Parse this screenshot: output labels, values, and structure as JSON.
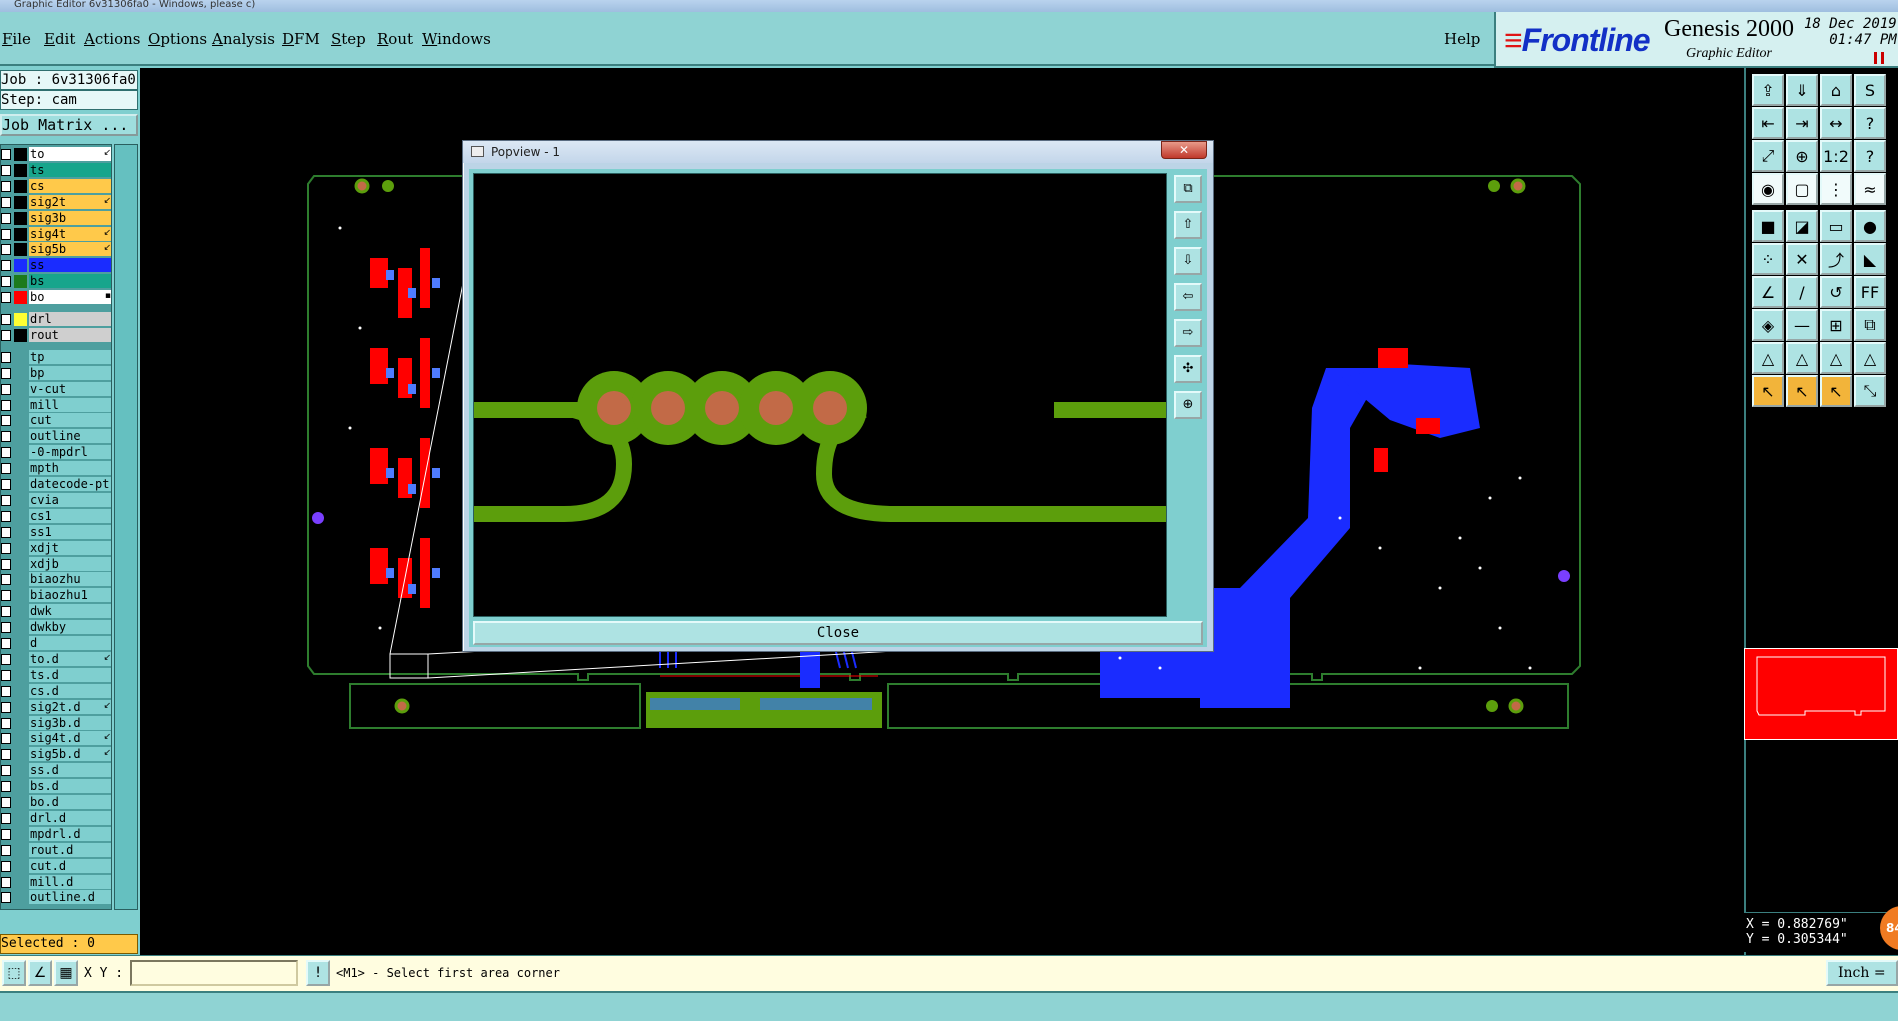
{
  "window_title": "Graphic Editor 6v31306fa0 - Windows, please c)",
  "menubar": {
    "items": [
      "File",
      "Edit",
      "Actions",
      "Options",
      "Analysis",
      "DFM",
      "Step",
      "Rout",
      "Windows"
    ],
    "help": "Help"
  },
  "brand": {
    "logo": "Frontline",
    "product": "Genesis 2000",
    "subtitle": "Graphic Editor",
    "date": "18 Dec 2019",
    "time": "01:47 PM"
  },
  "left_panel": {
    "job": "Job : 6v31306fa0",
    "step": "Step: cam",
    "job_matrix": "Job Matrix ...",
    "selected": "Selected : 0"
  },
  "layers": [
    {
      "name": "to",
      "swatch": "#000000",
      "bg": "#ffffff",
      "mark": "↙"
    },
    {
      "name": "ts",
      "swatch": "#000000",
      "bg": "#17a58c",
      "mark": ""
    },
    {
      "name": "cs",
      "swatch": "#000000",
      "bg": "#ffc94a",
      "mark": ""
    },
    {
      "name": "sig2t",
      "swatch": "#000000",
      "bg": "#ffc94a",
      "mark": "↙"
    },
    {
      "name": "sig3b",
      "swatch": "#000000",
      "bg": "#ffc94a",
      "mark": ""
    },
    {
      "name": "sig4t",
      "swatch": "#000000",
      "bg": "#ffc94a",
      "mark": "↙"
    },
    {
      "name": "sig5b",
      "swatch": "#000000",
      "bg": "#ffc94a",
      "mark": "↙"
    },
    {
      "name": "ss",
      "swatch": "#1a2cff",
      "bg": "#1a2cff",
      "mark": ""
    },
    {
      "name": "bs",
      "swatch": "#1c7a1c",
      "bg": "#17a58c",
      "mark": ""
    },
    {
      "name": "bo",
      "swatch": "#ff0000",
      "bg": "#ffffff",
      "mark": "▪"
    },
    {
      "name": "drl",
      "swatch": "#ffff33",
      "bg": "#cfcfcf",
      "mark": ""
    },
    {
      "name": "rout",
      "swatch": "#000000",
      "bg": "#cfcfcf",
      "mark": ""
    },
    {
      "name": "tp",
      "swatch": "",
      "bg": "#7fcfcf",
      "mark": ""
    },
    {
      "name": "bp",
      "swatch": "",
      "bg": "#7fcfcf",
      "mark": ""
    },
    {
      "name": "v-cut",
      "swatch": "",
      "bg": "#7fcfcf",
      "mark": ""
    },
    {
      "name": "mill",
      "swatch": "",
      "bg": "#7fcfcf",
      "mark": ""
    },
    {
      "name": "cut",
      "swatch": "",
      "bg": "#7fcfcf",
      "mark": ""
    },
    {
      "name": "outline",
      "swatch": "",
      "bg": "#7fcfcf",
      "mark": ""
    },
    {
      "name": "-0-mpdrl",
      "swatch": "",
      "bg": "#7fcfcf",
      "mark": ""
    },
    {
      "name": "mpth",
      "swatch": "",
      "bg": "#7fcfcf",
      "mark": ""
    },
    {
      "name": "datecode-pt",
      "swatch": "",
      "bg": "#7fcfcf",
      "mark": ""
    },
    {
      "name": "cvia",
      "swatch": "",
      "bg": "#7fcfcf",
      "mark": ""
    },
    {
      "name": "cs1",
      "swatch": "",
      "bg": "#7fcfcf",
      "mark": ""
    },
    {
      "name": "ss1",
      "swatch": "",
      "bg": "#7fcfcf",
      "mark": ""
    },
    {
      "name": "xdjt",
      "swatch": "",
      "bg": "#7fcfcf",
      "mark": ""
    },
    {
      "name": "xdjb",
      "swatch": "",
      "bg": "#7fcfcf",
      "mark": ""
    },
    {
      "name": "biaozhu",
      "swatch": "",
      "bg": "#7fcfcf",
      "mark": ""
    },
    {
      "name": "biaozhu1",
      "swatch": "",
      "bg": "#7fcfcf",
      "mark": ""
    },
    {
      "name": "dwk",
      "swatch": "",
      "bg": "#7fcfcf",
      "mark": ""
    },
    {
      "name": "dwkby",
      "swatch": "",
      "bg": "#7fcfcf",
      "mark": ""
    },
    {
      "name": "d",
      "swatch": "",
      "bg": "#7fcfcf",
      "mark": ""
    },
    {
      "name": "to.d",
      "swatch": "",
      "bg": "#7fcfcf",
      "mark": "↙"
    },
    {
      "name": "ts.d",
      "swatch": "",
      "bg": "#7fcfcf",
      "mark": ""
    },
    {
      "name": "cs.d",
      "swatch": "",
      "bg": "#7fcfcf",
      "mark": ""
    },
    {
      "name": "sig2t.d",
      "swatch": "",
      "bg": "#7fcfcf",
      "mark": "↙"
    },
    {
      "name": "sig3b.d",
      "swatch": "",
      "bg": "#7fcfcf",
      "mark": ""
    },
    {
      "name": "sig4t.d",
      "swatch": "",
      "bg": "#7fcfcf",
      "mark": "↙"
    },
    {
      "name": "sig5b.d",
      "swatch": "",
      "bg": "#7fcfcf",
      "mark": "↙"
    },
    {
      "name": "ss.d",
      "swatch": "",
      "bg": "#7fcfcf",
      "mark": ""
    },
    {
      "name": "bs.d",
      "swatch": "",
      "bg": "#7fcfcf",
      "mark": ""
    },
    {
      "name": "bo.d",
      "swatch": "",
      "bg": "#7fcfcf",
      "mark": ""
    },
    {
      "name": "drl.d",
      "swatch": "",
      "bg": "#7fcfcf",
      "mark": ""
    },
    {
      "name": "mpdrl.d",
      "swatch": "",
      "bg": "#7fcfcf",
      "mark": ""
    },
    {
      "name": "rout.d",
      "swatch": "",
      "bg": "#7fcfcf",
      "mark": ""
    },
    {
      "name": "cut.d",
      "swatch": "",
      "bg": "#7fcfcf",
      "mark": ""
    },
    {
      "name": "mill.d",
      "swatch": "",
      "bg": "#7fcfcf",
      "mark": ""
    },
    {
      "name": "outline.d",
      "swatch": "",
      "bg": "#7fcfcf",
      "mark": ""
    }
  ],
  "popview": {
    "title": "Popview - 1",
    "close_label": "Close",
    "close_x": "✕"
  },
  "right_tools": {
    "tool_icons": [
      "home-page-icon",
      "save-page-icon",
      "house-icon",
      "s-shape-icon",
      "prev-icon",
      "next-icon",
      "ratio-icon",
      "step-icon",
      "fit-icon",
      "center-icon",
      "one-to-two-icon",
      "help-icon",
      "pad-icon",
      "grid-icon",
      "net-icon",
      "route-icon",
      "snap-icon",
      "mirror-icon",
      "measure-icon",
      "record-icon",
      "node-icon",
      "cross-icon",
      "arc-icon",
      "angle-icon",
      "line-icon",
      "slash-icon",
      "undo-icon",
      "ff-icon",
      "feature-icon",
      "dash-icon",
      "target-icon",
      "layer-icon",
      "triangle-icon",
      "triangle-a-icon",
      "triangle-b-icon",
      "triangle-c-icon",
      "pointer-icon",
      "pointer-gold-icon",
      "pointer-box-icon",
      "route-gold-icon"
    ]
  },
  "coordinates": {
    "x": "X = 0.882769\"",
    "y": "Y = 0.305344\""
  },
  "badge": "84",
  "statusbar": {
    "xy_label": "X Y :",
    "xy_value": "",
    "alert": "!",
    "message": "<M1> - Select first area corner",
    "units": "Inch"
  },
  "colors": {
    "canvas": "#000000",
    "trace_green": "#5c9e0c",
    "pad_copper": "#c26a47",
    "fill_blue": "#1a2cff",
    "outline_green": "#2e7d2e",
    "annotation_red": "#ff0000"
  }
}
